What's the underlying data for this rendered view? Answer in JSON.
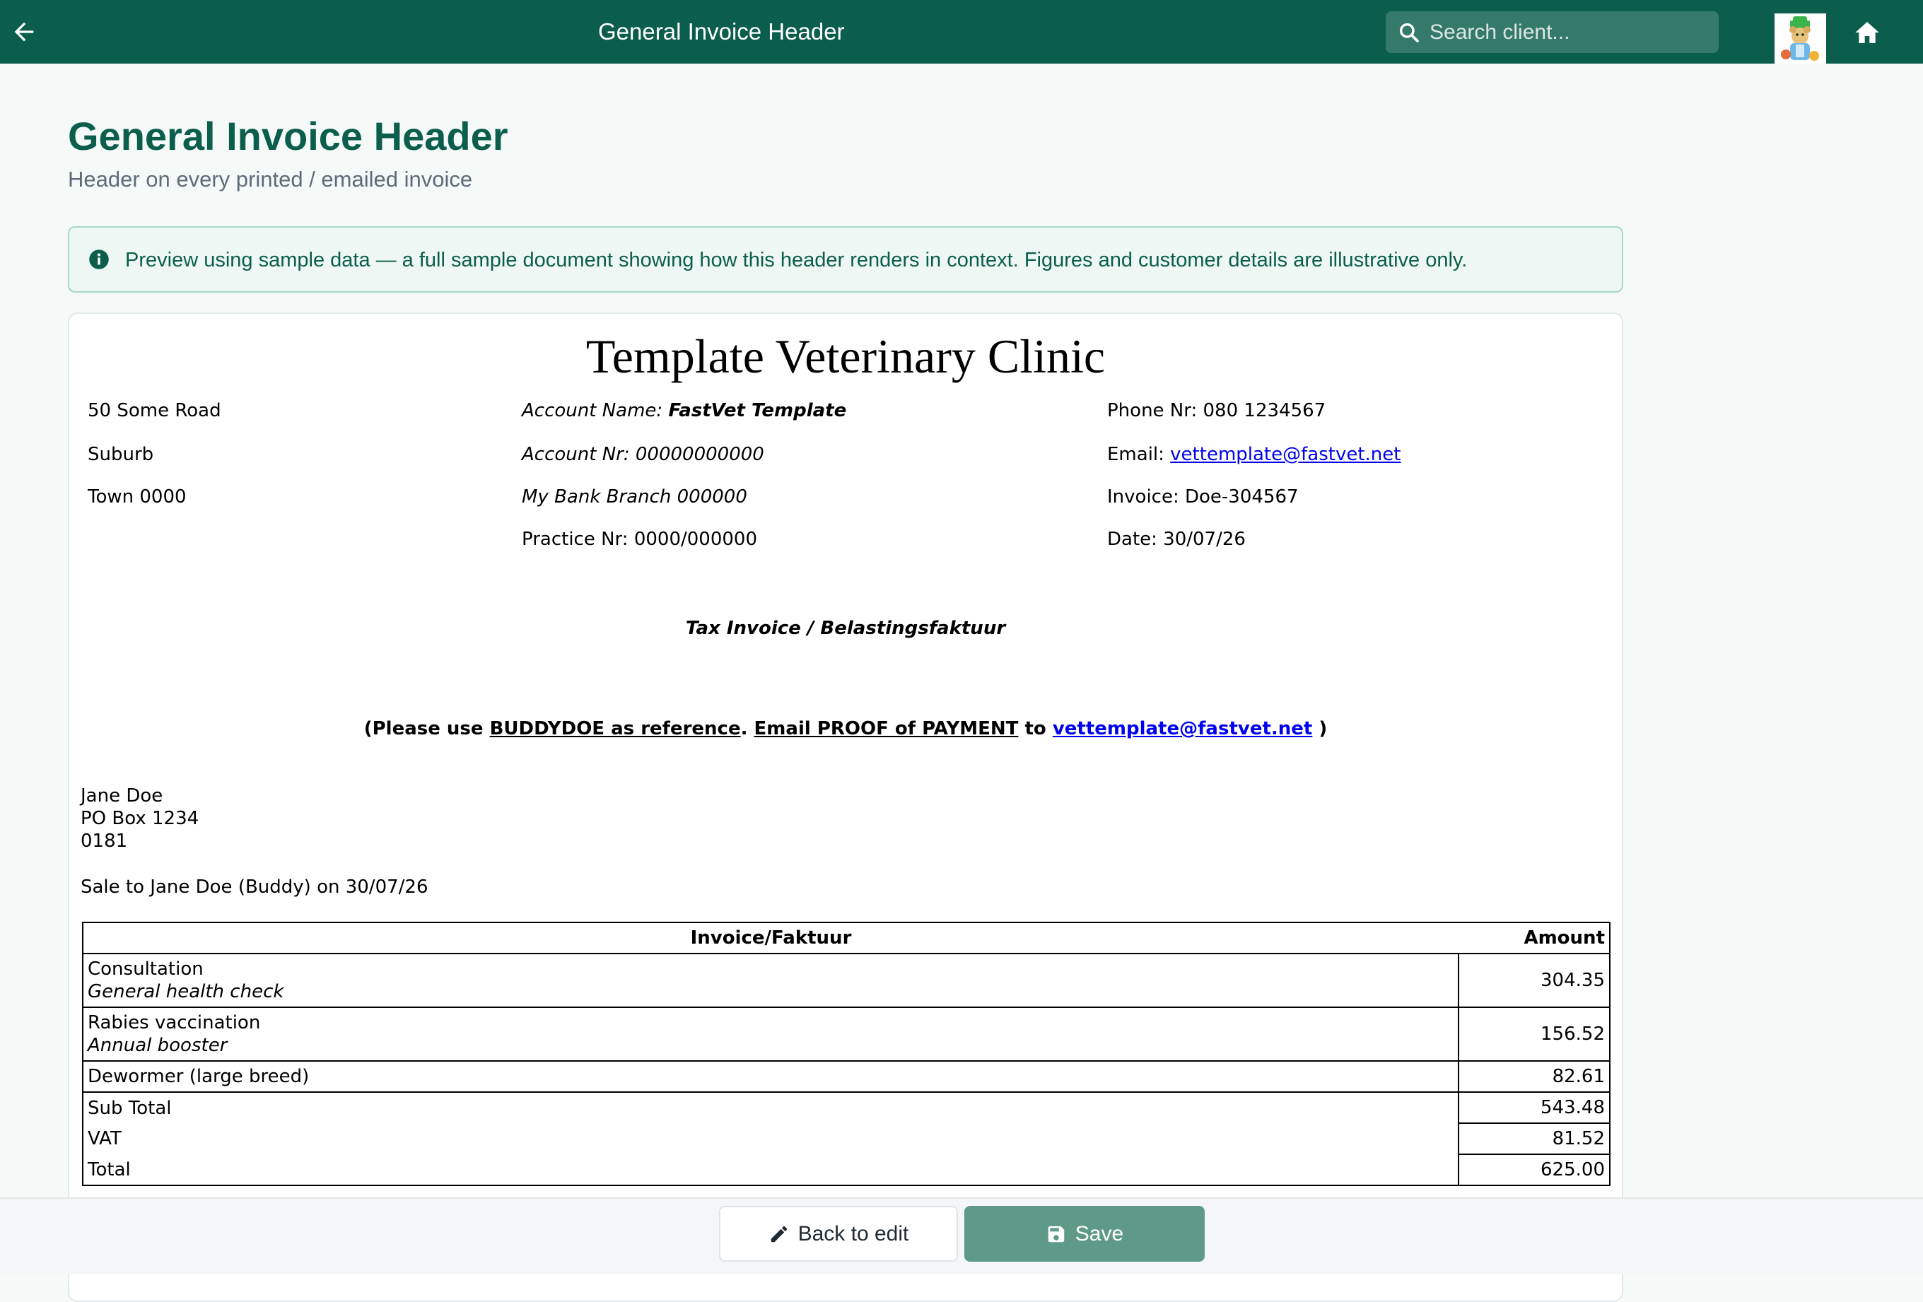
{
  "topbar": {
    "title": "General Invoice Header",
    "search_placeholder": "Search client...",
    "back_icon": "arrow-left-icon",
    "search_icon": "search-icon",
    "home_icon": "home-icon"
  },
  "page": {
    "title": "General Invoice Header",
    "subtitle": "Header on every printed / emailed invoice"
  },
  "info_banner": {
    "icon": "info-icon",
    "text": "Preview using sample data — a full sample document showing how this header renders in context. Figures and customer details are illustrative only."
  },
  "invoice": {
    "clinic_name": "Template Veterinary Clinic",
    "address": {
      "line1": "50 Some Road",
      "line2": "Suburb",
      "line3": "Town 0000"
    },
    "account_name_label": "Account Name: ",
    "account_name": "FastVet Template",
    "account_nr": "Account Nr: 00000000000",
    "bank_branch": "My Bank Branch 000000",
    "practice_nr": "Practice Nr: 0000/000000",
    "phone": "Phone Nr: 080 1234567",
    "email_label": "Email: ",
    "email": "vettemplate@fastvet.net",
    "invoice_nr": "Invoice: Doe-304567",
    "date": "Date: 30/07/26",
    "doc_type": "Tax Invoice / Belastingsfaktuur",
    "reference": {
      "open": "(Please use ",
      "ref": "BUDDYDOE as reference",
      "sep": ". ",
      "email_proof": "Email PROOF of PAYMENT",
      "to": " to ",
      "email": "vettemplate@fastvet.net",
      "close": " )"
    },
    "client": {
      "name": "Jane Doe",
      "box": "PO Box 1234",
      "code": "0181"
    },
    "sale_line": "Sale to Jane Doe (Buddy) on 30/07/26",
    "table": {
      "header_desc": "Invoice/Faktuur",
      "header_amount": "Amount",
      "items": [
        {
          "name": "Consultation",
          "detail": "General health check",
          "amount": "304.35"
        },
        {
          "name": "Rabies vaccination",
          "detail": "Annual booster",
          "amount": "156.52"
        },
        {
          "name": "Dewormer (large breed)",
          "amount": "82.61"
        }
      ],
      "subtotal_label": "Sub Total",
      "subtotal": "543.48",
      "vat_label": "VAT",
      "vat": "81.52",
      "total_label": "Total",
      "total": "625.00"
    }
  },
  "actions": {
    "back_label": "Back to edit",
    "back_icon": "pencil-icon",
    "save_label": "Save",
    "save_icon": "floppy-disk-icon"
  },
  "colors": {
    "brand": "#0b5e4b",
    "save_button": "#5e9a87",
    "banner_bg": "#eef7f4",
    "link": "#0000ee"
  }
}
